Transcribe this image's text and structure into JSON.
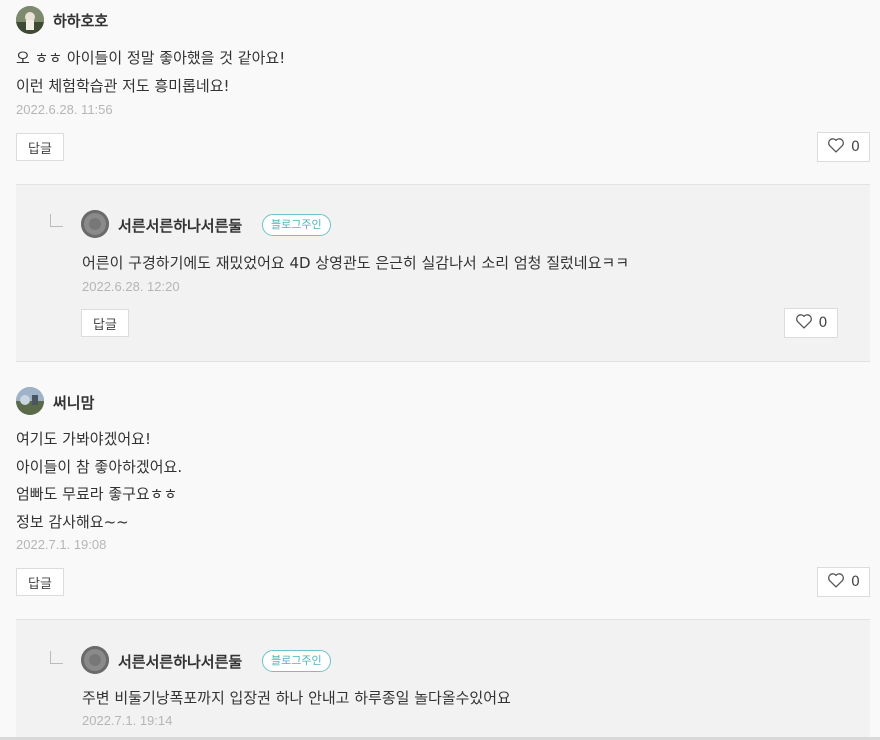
{
  "comments": [
    {
      "author": "하하호호",
      "lines": [
        "오 ㅎㅎ 아이들이 정말 좋아했을 것 같아요!",
        "이런 체험학습관 저도 흥미롭네요!"
      ],
      "date": "2022.6.28. 11:56",
      "reply_label": "답글",
      "likes": "0",
      "reply": {
        "author": "서른서른하나서른둘",
        "badge": "블로그주인",
        "lines": [
          "어른이 구경하기에도 재밌었어요 4D 상영관도 은근히 실감나서 소리 엄청 질렀네요ㅋㅋ"
        ],
        "date": "2022.6.28. 12:20",
        "reply_label": "답글",
        "likes": "0"
      }
    },
    {
      "author": "써니맘",
      "lines": [
        "여기도 가봐야겠어요!",
        "아이들이 참 좋아하겠어요.",
        "엄빠도 무료라 좋구요ㅎㅎ",
        "정보 감사해요~~"
      ],
      "date": "2022.7.1. 19:08",
      "reply_label": "답글",
      "likes": "0",
      "reply": {
        "author": "서른서른하나서른둘",
        "badge": "블로그주인",
        "lines": [
          "주변 비둘기낭폭포까지 입장권 하나 안내고 하루종일 놀다올수있어요"
        ],
        "date": "2022.7.1. 19:14"
      }
    }
  ],
  "icons": {
    "like": "heart-outline-icon",
    "indent": "reply-indent-icon"
  }
}
